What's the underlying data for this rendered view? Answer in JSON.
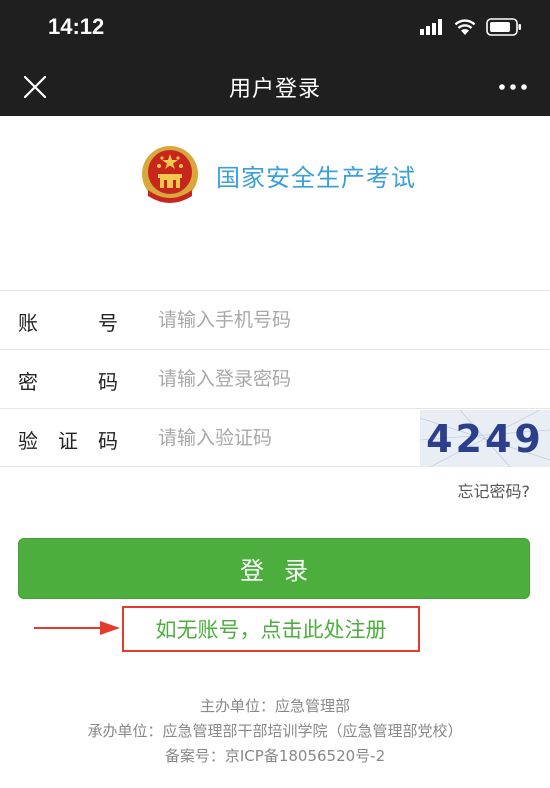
{
  "status": {
    "time": "14:12"
  },
  "nav": {
    "title": "用户登录"
  },
  "brand": {
    "name": "国家安全生产考试"
  },
  "form": {
    "rows": [
      {
        "label_chars": [
          "账",
          "号"
        ],
        "placeholder": "请输入手机号码",
        "value": ""
      },
      {
        "label_chars": [
          "密",
          "码"
        ],
        "placeholder": "请输入登录密码",
        "value": ""
      },
      {
        "label_chars": [
          "验",
          "证",
          "码"
        ],
        "placeholder": "请输入验证码",
        "value": ""
      }
    ],
    "captcha_text": "4249",
    "forgot_label": "忘记密码?"
  },
  "login": {
    "label": "登录"
  },
  "register": {
    "label": "如无账号，点击此处注册"
  },
  "footer": {
    "host": "主办单位：应急管理部",
    "organizer": "承办单位：应急管理部干部培训学院（应急管理部党校）",
    "icp": "备案号：京ICP备18056520号-2"
  },
  "colors": {
    "accent_green": "#4caf3d",
    "brand_blue": "#3aa0d8",
    "highlight_red": "#e53b2f",
    "bar_dark": "#1f1f1f"
  }
}
